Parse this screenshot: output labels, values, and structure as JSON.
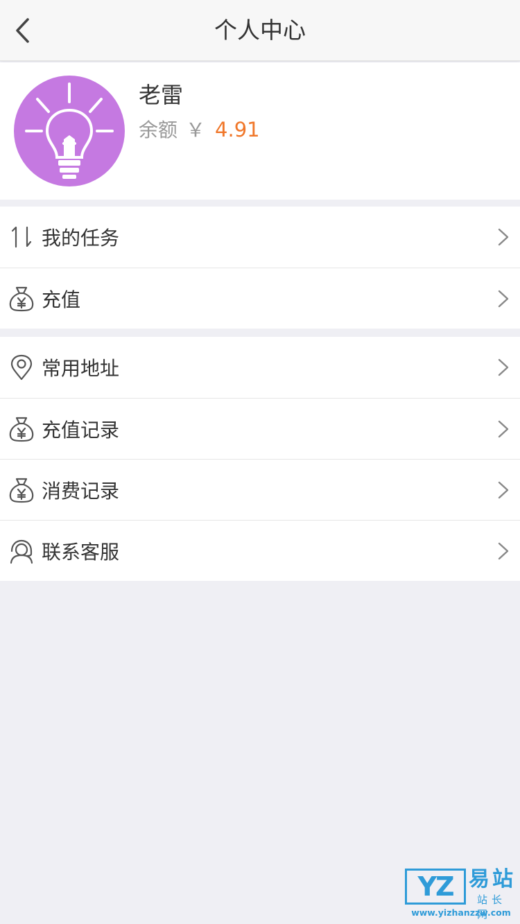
{
  "navbar": {
    "title": "个人中心"
  },
  "profile": {
    "name": "老雷",
    "balance_label": "余额",
    "currency_symbol": "￥",
    "balance_amount": "4.91",
    "avatar_color": "#c579e1"
  },
  "menu_group_1": [
    {
      "label": "我的任务",
      "icon": "sort-arrows-icon"
    },
    {
      "label": "充值",
      "icon": "money-bag-icon"
    }
  ],
  "menu_group_2": [
    {
      "label": "常用地址",
      "icon": "location-pin-icon"
    },
    {
      "label": "充值记录",
      "icon": "money-bag-icon"
    },
    {
      "label": "消费记录",
      "icon": "money-bag-icon"
    },
    {
      "label": "联系客服",
      "icon": "customer-service-icon"
    }
  ],
  "watermark": {
    "logo_letters": "YZ",
    "cn_top": "易站",
    "cn_bottom": "站长网",
    "url": "www.yizhanzzw.com"
  },
  "colors": {
    "accent_amount": "#f0772a",
    "watermark_blue": "#2e9bd8",
    "background": "#efeff4"
  }
}
